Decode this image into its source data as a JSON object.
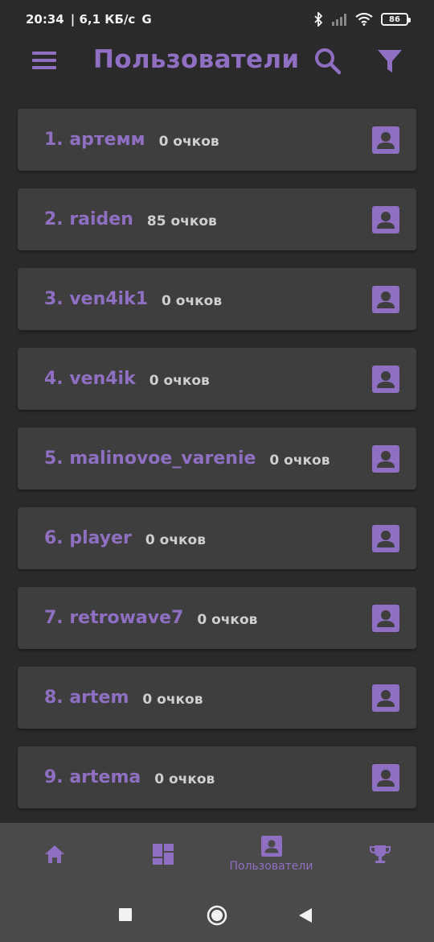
{
  "status": {
    "time": "20:34",
    "network_speed": "| 6,1 КБ/с",
    "g_letter": "G",
    "battery": "86"
  },
  "app_bar": {
    "title": "Пользователи",
    "menu_icon": "hamburger-menu-icon",
    "search_icon": "search-icon",
    "filter_icon": "filter-icon"
  },
  "users": [
    {
      "name": "1. артемм",
      "score": "0 очков"
    },
    {
      "name": "2. raiden",
      "score": "85 очков"
    },
    {
      "name": "3. ven4ik1",
      "score": "0 очков"
    },
    {
      "name": "4. ven4ik",
      "score": "0 очков"
    },
    {
      "name": "5. malinovoe_varenie",
      "score": "0 очков"
    },
    {
      "name": "6. player",
      "score": "0 очков"
    },
    {
      "name": "7. retrowave7",
      "score": "0 очков"
    },
    {
      "name": "8. artem",
      "score": "0 очков"
    },
    {
      "name": "9. artema",
      "score": "0 очков"
    }
  ],
  "bottom_nav": {
    "active_label": "Пользователи",
    "items": [
      "home-icon",
      "dashboard-icon",
      "user-profile-icon",
      "trophy-icon"
    ]
  },
  "colors": {
    "accent": "#8e6fc1",
    "background": "#2a2a2a",
    "card": "#3e3e3e",
    "nav": "#4a4a4a"
  }
}
